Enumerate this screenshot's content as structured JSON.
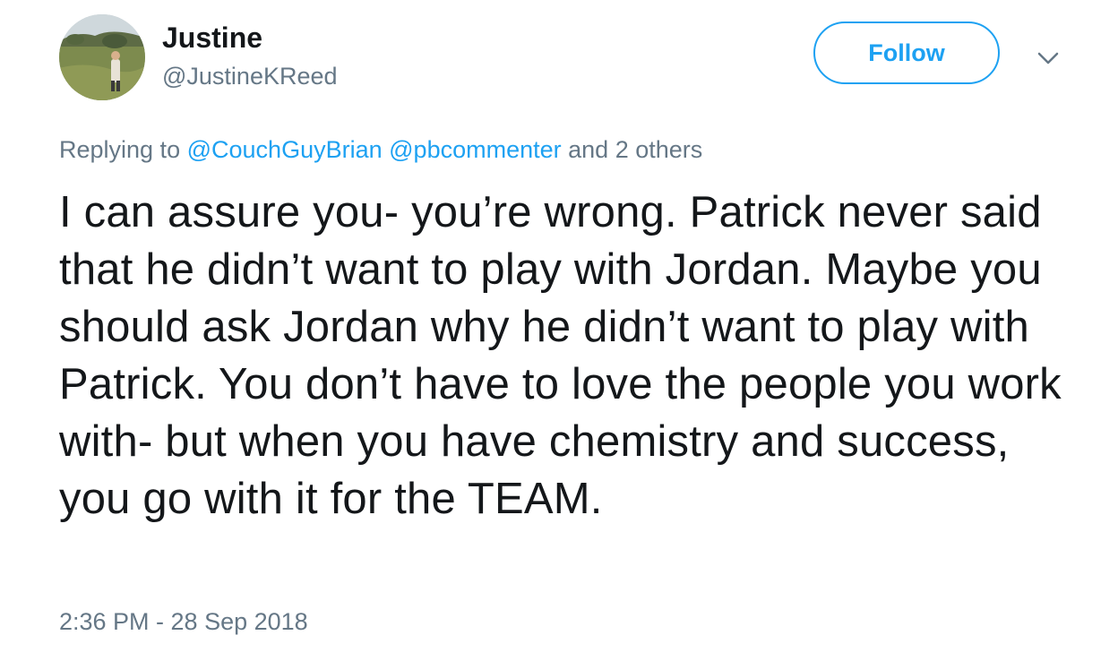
{
  "author": {
    "display_name": "Justine",
    "handle": "@JustineKReed"
  },
  "actions": {
    "follow_label": "Follow",
    "more_icon": "chevron-down-icon"
  },
  "reply": {
    "prefix": "Replying to",
    "mentions": [
      "@CouchGuyBrian",
      "@pbcommenter"
    ],
    "suffix": "and 2 others"
  },
  "tweet": {
    "text": "I can assure you- you’re wrong. Patrick never said that he didn’t want to play with Jordan. Maybe you should ask Jordan why he didn’t want to play with Patrick. You don’t have to love the people you work with- but when you have chemistry and success, you go with it for the TEAM.",
    "timestamp": "2:36 PM - 28 Sep 2018"
  },
  "colors": {
    "accent": "#1da1f2",
    "secondary_text": "#657786",
    "primary_text": "#14171a"
  }
}
